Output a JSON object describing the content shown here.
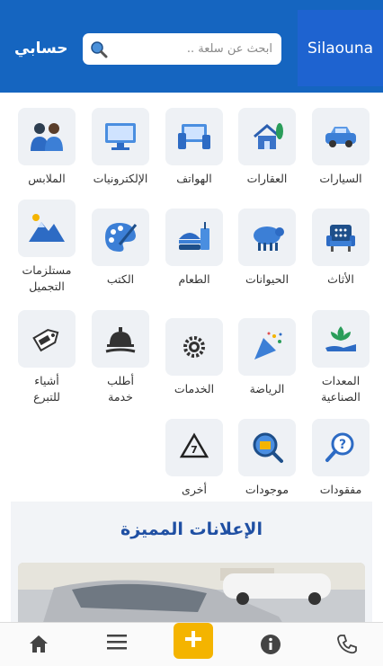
{
  "header": {
    "brand": "Silaouna",
    "search_placeholder": "ابحث عن سلعة ..",
    "account_label": "حسابي"
  },
  "categories": [
    {
      "label": "السيارات",
      "icon": "car-icon"
    },
    {
      "label": "العقارات",
      "icon": "house-icon"
    },
    {
      "label": "الهواتف",
      "icon": "devices-icon"
    },
    {
      "label": "الإلكترونيات",
      "icon": "monitor-icon"
    },
    {
      "label": "الملابس",
      "icon": "people-icon"
    },
    {
      "label": "الأثاث",
      "icon": "armchair-icon"
    },
    {
      "label": "الحيوانات",
      "icon": "sheep-icon"
    },
    {
      "label": "الطعام",
      "icon": "food-icon"
    },
    {
      "label": "الكتب",
      "icon": "palette-icon"
    },
    {
      "label": "مستلزمات\nالتجميل",
      "icon": "mountain-icon"
    },
    {
      "label": "المعدات\nالصناعية",
      "icon": "plant-hand-icon"
    },
    {
      "label": "الرياضة",
      "icon": "party-popper-icon"
    },
    {
      "label": "الخدمات",
      "icon": "gear-icon"
    },
    {
      "label": "أطلب\nخدمة",
      "icon": "service-bell-icon"
    },
    {
      "label": "أشياء\nللتبرع",
      "icon": "free-tag-icon"
    },
    {
      "label": "مفقودات",
      "icon": "lost-search-icon"
    },
    {
      "label": "موجودات",
      "icon": "found-search-icon"
    },
    {
      "label": "أخرى",
      "icon": "recycle-icon"
    }
  ],
  "featured": {
    "title": "الإعلانات المميزة"
  },
  "colors": {
    "header": "#1565c0",
    "accent": "#1f4fa3",
    "add_button": "#f4b400"
  }
}
